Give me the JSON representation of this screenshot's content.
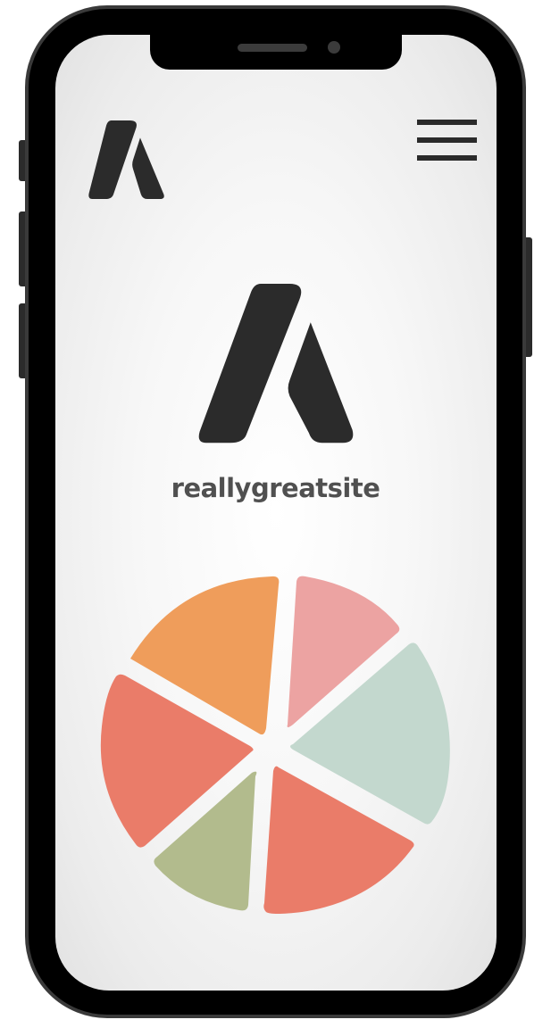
{
  "device": {
    "frame_color": "#000000",
    "screen_color": "#f5f5f5"
  },
  "header": {
    "logo_icon": "brand-logo-icon",
    "menu_icon": "hamburger-menu-icon"
  },
  "main": {
    "logo_icon": "brand-logo-icon",
    "site_name": "reallygreatsite"
  },
  "colors": {
    "logo": "#2b2b2b",
    "orange": "#ef9d5b",
    "pink": "#eca3a2",
    "mint": "#c3d8ce",
    "coral": "#ea7c69",
    "sage": "#b2bb8d"
  },
  "chart_data": {
    "type": "pie",
    "slices": [
      {
        "color": "#ef9d5b"
      },
      {
        "color": "#eca3a2"
      },
      {
        "color": "#c3d8ce"
      },
      {
        "color": "#ea7c69"
      },
      {
        "color": "#b2bb8d"
      },
      {
        "color": "#ea7c69"
      }
    ]
  }
}
